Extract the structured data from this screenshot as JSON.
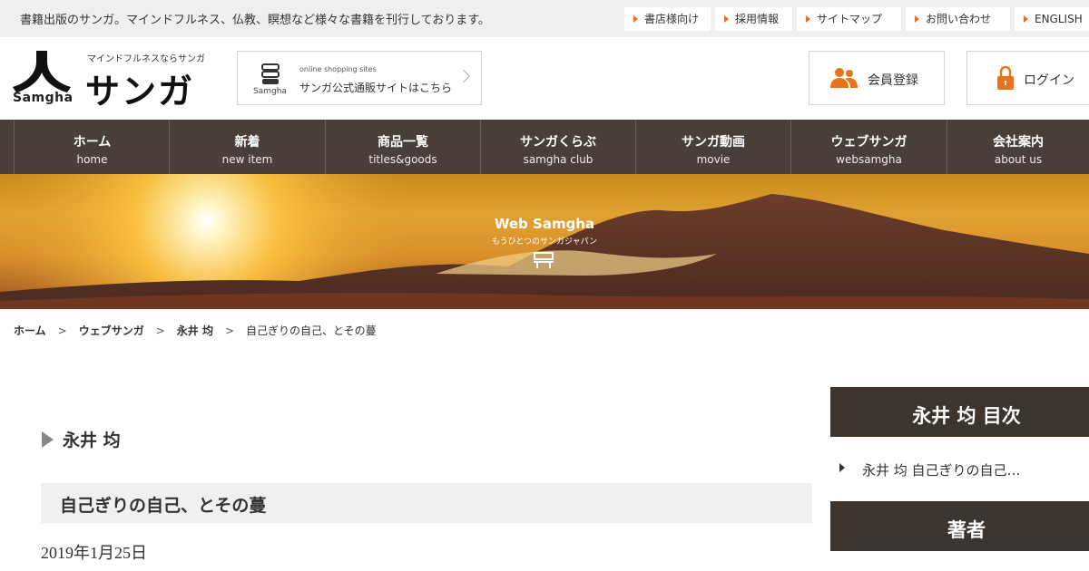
{
  "topbar": {
    "tagline": "書籍出版のサンガ。マインドフルネス、仏教、瞑想など様々な書籍を刊行しております。",
    "links": [
      {
        "label": "書店様向け"
      },
      {
        "label": "採用情報"
      },
      {
        "label": "サイトマップ"
      },
      {
        "label": "お問い合わせ"
      },
      {
        "label": "ENGLISH"
      }
    ]
  },
  "header": {
    "logo_sub": "マインドフルネスならサンガ",
    "logo_main": "サンガ",
    "logo_mark_text": "Samgha",
    "shop": {
      "icon_label": "Samgha",
      "small": "online shopping sites",
      "label": "サンガ公式通販サイトはこちら"
    },
    "register_label": "会員登録",
    "login_label": "ログイン",
    "accent_color": "#e8731a"
  },
  "nav": [
    {
      "jp": "ホーム",
      "en": "home"
    },
    {
      "jp": "新着",
      "en": "new item"
    },
    {
      "jp": "商品一覧",
      "en": "titles&goods"
    },
    {
      "jp": "サンガくらぶ",
      "en": "samgha club"
    },
    {
      "jp": "サンガ動画",
      "en": "movie"
    },
    {
      "jp": "ウェブサンガ",
      "en": "websamgha"
    },
    {
      "jp": "会社案内",
      "en": "about us"
    }
  ],
  "hero": {
    "title": "Web Samgha",
    "subtitle": "もうひとつのサンガジャパン"
  },
  "breadcrumb": {
    "items": [
      "ホーム",
      "ウェブサンガ",
      "永井 均"
    ],
    "separator": ">",
    "current": "自己ぎりの自己、とその蔓"
  },
  "main": {
    "author": "永井 均",
    "article_title": "自己ぎりの自己、とその蔓",
    "date": "2019年1月25日"
  },
  "sidebar": {
    "toc_heading": "永井 均 目次",
    "toc_item": "永井 均 自己ぎりの自己…",
    "author_heading": "著者"
  }
}
